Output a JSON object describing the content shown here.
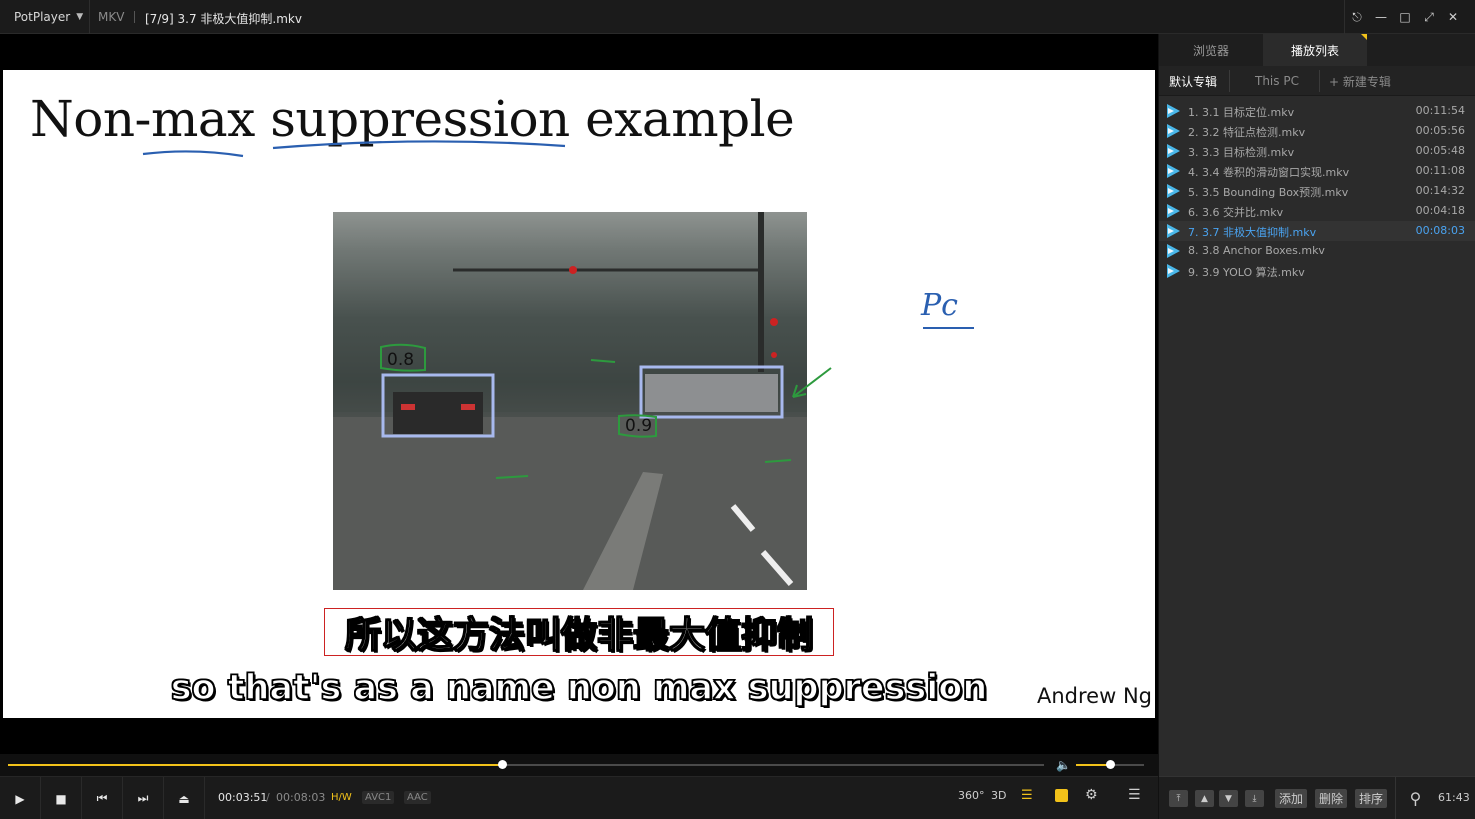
{
  "titlebar": {
    "app_name": "PotPlayer",
    "format": "MKV",
    "file_title": "[7/9] 3.7 非极大值抑制.mkv",
    "icons": [
      "pin-icon",
      "minimize-icon",
      "maximize-icon",
      "fullscreen-icon",
      "close-icon"
    ]
  },
  "video": {
    "slide_title": "Non-max suppression example",
    "scores": [
      "0.8",
      "0.9"
    ],
    "annotation": "Pc",
    "subtitle_cn": "所以这方法叫做非最大值抑制",
    "subtitle_en": "so that's as a name non max suppression",
    "credit": "Andrew Ng"
  },
  "seek": {
    "progress": 0.477,
    "volume": 0.5
  },
  "controls": {
    "time_current": "00:03:51",
    "time_sep": "/",
    "time_total": "00:08:03",
    "hw": "H/W",
    "video_codec": "AVC1",
    "audio_codec": "AAC",
    "btn_360": "360°",
    "btn_3d": "3D"
  },
  "panel": {
    "tabs": [
      "浏览器",
      "播放列表"
    ],
    "albums": [
      "默认专辑",
      "This PC",
      "+ 新建专辑"
    ],
    "playlist": [
      {
        "name": "1. 3.1 目标定位.mkv",
        "duration": "00:11:54"
      },
      {
        "name": "2. 3.2 特征点检测.mkv",
        "duration": "00:05:56"
      },
      {
        "name": "3. 3.3 目标检测.mkv",
        "duration": "00:05:48"
      },
      {
        "name": "4. 3.4 卷积的滑动窗口实现.mkv",
        "duration": "00:11:08"
      },
      {
        "name": "5. 3.5 Bounding Box预测.mkv",
        "duration": "00:14:32"
      },
      {
        "name": "6. 3.6 交并比.mkv",
        "duration": "00:04:18"
      },
      {
        "name": "7. 3.7 非极大值抑制.mkv",
        "duration": "00:08:03"
      },
      {
        "name": "8. 3.8 Anchor Boxes.mkv",
        "duration": ""
      },
      {
        "name": "9. 3.9 YOLO 算法.mkv",
        "duration": ""
      }
    ],
    "bottom": {
      "add": "添加",
      "delete": "删除",
      "sort": "排序",
      "count": "61:43"
    }
  }
}
